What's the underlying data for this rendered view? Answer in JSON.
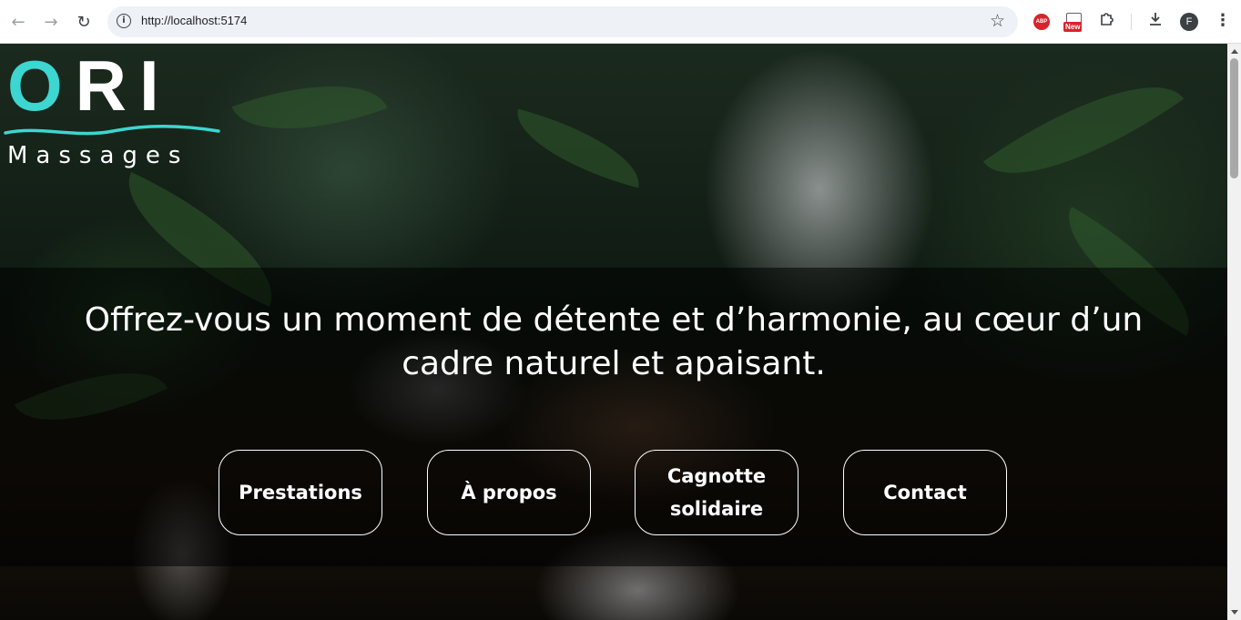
{
  "browser": {
    "url": "http://localhost:5174",
    "avatar_letter": "F",
    "ext_abp_label": "ABP",
    "ext_new_badge": "New"
  },
  "logo": {
    "word_first": "O",
    "word_rest": "RI",
    "subtitle": "Massages",
    "accent_color": "#3dd6d0"
  },
  "hero": {
    "tagline": "Offrez-vous un moment de détente et d’harmonie, au cœur d’un cadre naturel et apaisant."
  },
  "buttons": {
    "prestations": "Prestations",
    "apropos": "À propos",
    "cagnotte_line1": "Cagnotte",
    "cagnotte_line2": "solidaire",
    "contact": "Contact"
  },
  "icons": {
    "back": "arrow-left-icon",
    "forward": "arrow-right-icon",
    "reload": "reload-icon",
    "info": "info-icon",
    "star": "star-icon",
    "extensions": "puzzle-icon",
    "download": "download-icon",
    "menu": "kebab-menu-icon"
  }
}
